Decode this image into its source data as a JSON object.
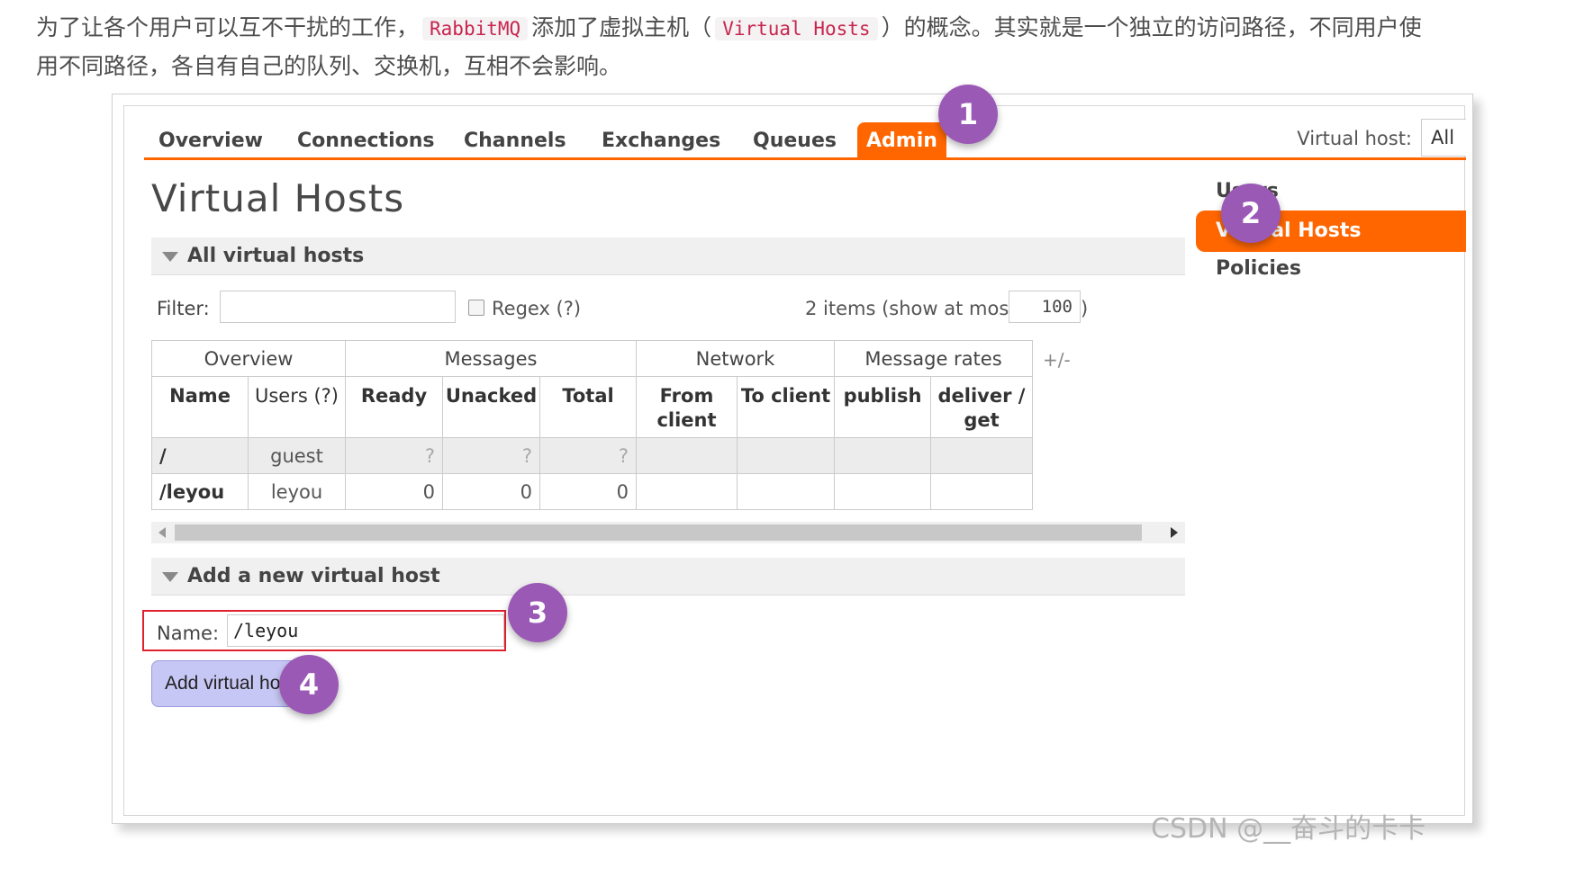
{
  "intro": {
    "p1": "为了让各个用户可以互不干扰的工作，",
    "code1": "RabbitMQ",
    "p2": "添加了虚拟主机（",
    "code2": "Virtual Hosts",
    "p3": "）的概念。其实就是一个独立的访问路径，不同用户使",
    "p4": "用不同路径，各自有自己的队列、交换机，互相不会影响。"
  },
  "nav": {
    "tabs": [
      "Overview",
      "Connections",
      "Channels",
      "Exchanges",
      "Queues",
      "Admin"
    ],
    "active_tab": "Admin",
    "vhost_label": "Virtual host:",
    "vhost_value": "All"
  },
  "sidebar": {
    "items": [
      "Users",
      "Virtual Hosts",
      "Policies"
    ],
    "active": "Virtual Hosts"
  },
  "page_title": "Virtual Hosts",
  "all_section": {
    "title": "All virtual hosts",
    "filter_label": "Filter:",
    "filter_value": "",
    "regex_label": "Regex (?)",
    "items_text": "2 items (show at most",
    "max_value": "100",
    "paren_close": ")",
    "plus_minus": "+/-"
  },
  "table": {
    "groups": [
      "Overview",
      "Messages",
      "Network",
      "Message rates"
    ],
    "columns": {
      "name": "Name",
      "users": "Users (?)",
      "ready": "Ready",
      "unacked": "Unacked",
      "total": "Total",
      "from_client": "From client",
      "to_client": "To client",
      "publish": "publish",
      "deliver_get": "deliver / get"
    },
    "rows": [
      {
        "name": "/",
        "users": "guest",
        "ready": "?",
        "unacked": "?",
        "total": "?",
        "from_client": "",
        "to_client": "",
        "publish": "",
        "deliver_get": ""
      },
      {
        "name": "/leyou",
        "users": "leyou",
        "ready": "0",
        "unacked": "0",
        "total": "0",
        "from_client": "",
        "to_client": "",
        "publish": "",
        "deliver_get": ""
      }
    ]
  },
  "add_section": {
    "title": "Add a new virtual host",
    "name_label": "Name:",
    "name_value": "/leyou",
    "required_mark": "*",
    "button_label": "Add virtual host"
  },
  "badges": [
    "1",
    "2",
    "3",
    "4"
  ],
  "watermark": "CSDN @__奋斗的卡卡",
  "colors": {
    "accent": "#ff6600",
    "badge": "#9b59b6",
    "highlight_border": "#e0202e",
    "button": "#c7c7f5"
  }
}
